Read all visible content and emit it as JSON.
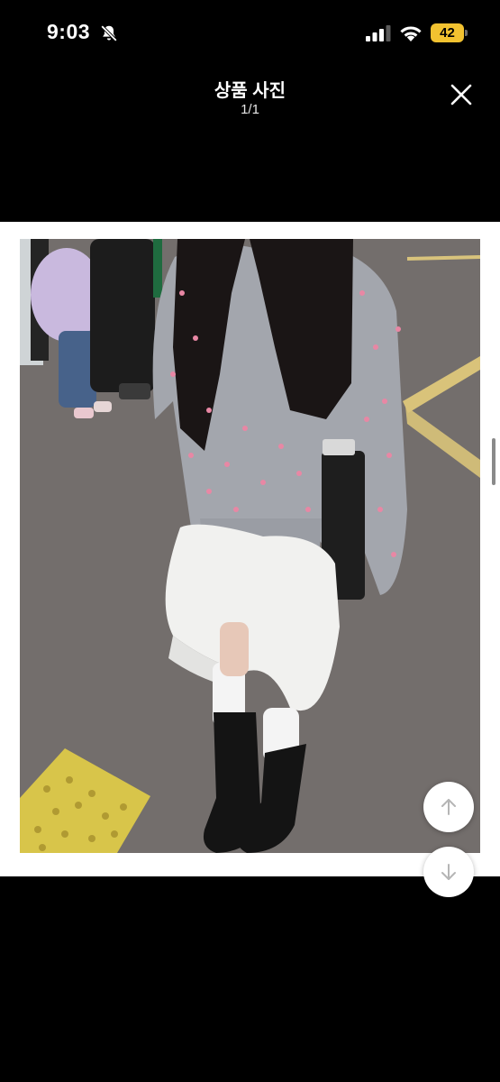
{
  "status_bar": {
    "time": "9:03",
    "battery_level": "42",
    "battery_color": "#f2c230",
    "icons": [
      "bell-slash-icon",
      "cellular-signal-icon",
      "wifi-icon",
      "battery-icon"
    ]
  },
  "header": {
    "title": "상품 사진",
    "counter": "1/1",
    "close_icon": "close-icon"
  },
  "photo": {
    "alt": "상품 사진"
  },
  "buttons": {
    "scroll_up_icon": "arrow-up-icon",
    "scroll_down_icon": "arrow-down-icon"
  },
  "colors": {
    "background": "#000000",
    "content_background": "#ffffff"
  }
}
